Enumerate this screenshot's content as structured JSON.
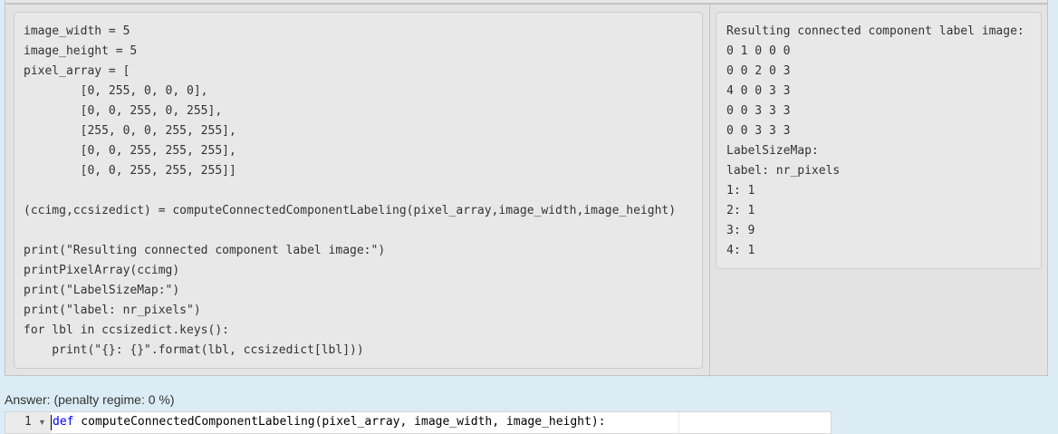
{
  "example": {
    "test_lines": [
      "image_width = 5",
      "image_height = 5",
      "pixel_array = [",
      "        [0, 255, 0, 0, 0],",
      "        [0, 0, 255, 0, 255],",
      "        [255, 0, 0, 255, 255],",
      "        [0, 0, 255, 255, 255],",
      "        [0, 0, 255, 255, 255]]",
      "",
      "(ccimg,ccsizedict) = computeConnectedComponentLabeling(pixel_array,image_width,image_height)",
      "",
      "print(\"Resulting connected component label image:\")",
      "printPixelArray(ccimg)",
      "print(\"LabelSizeMap:\")",
      "print(\"label: nr_pixels\")",
      "for lbl in ccsizedict.keys():",
      "    print(\"{}: {}\".format(lbl, ccsizedict[lbl]))"
    ],
    "result_lines": [
      "Resulting connected component label image:",
      "0 1 0 0 0",
      "0 0 2 0 3",
      "4 0 0 3 3",
      "0 0 3 3 3",
      "0 0 3 3 3",
      "LabelSizeMap:",
      "label: nr_pixels",
      "1: 1",
      "2: 1",
      "3: 9",
      "4: 1"
    ]
  },
  "answer": {
    "label": "Answer:  (penalty regime: 0 %)",
    "line_number": "1",
    "fold_icon": "fold-toggle",
    "keyword": "def",
    "code_rest": " computeConnectedComponentLabeling(pixel_array, image_width, image_height):"
  }
}
